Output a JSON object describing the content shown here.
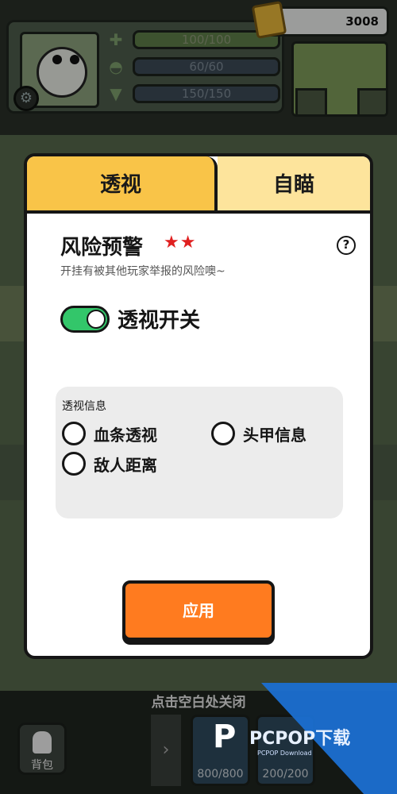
{
  "hud": {
    "stats": [
      {
        "icon": "plus-icon",
        "value": "100/100"
      },
      {
        "icon": "helmet-icon",
        "value": "60/60"
      },
      {
        "icon": "armor-icon",
        "value": "150/150"
      }
    ],
    "coins": "3008"
  },
  "modal": {
    "tabs": [
      {
        "label": "透视",
        "active": true
      },
      {
        "label": "自瞄",
        "active": false
      }
    ],
    "risk": {
      "title": "风险预警",
      "stars": "★★",
      "help": "?",
      "description": "开挂有被其他玩家举报的风险噢~"
    },
    "toggle": {
      "label": "透视开关",
      "on": true
    },
    "info": {
      "title": "透视信息",
      "options": [
        {
          "label": "血条透视",
          "checked": false
        },
        {
          "label": "头甲信息",
          "checked": false
        },
        {
          "label": "敌人距离",
          "checked": false
        }
      ]
    },
    "apply_label": "应用"
  },
  "footer": {
    "close_hint": "点击空白处关闭",
    "bag_label": "背包",
    "items": [
      "800/800",
      "200/200"
    ]
  },
  "watermark": {
    "text": "PCPOP下载",
    "sub": "PCPOP Download"
  },
  "colors": {
    "accent_tab": "#f9c448",
    "toggle_on": "#33c66a",
    "apply": "#ff7b1f",
    "stars": "#e02020"
  }
}
